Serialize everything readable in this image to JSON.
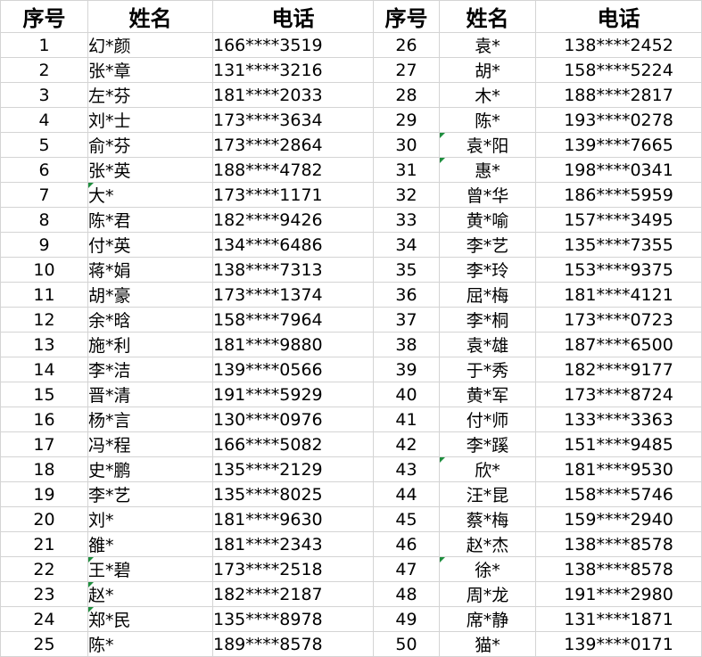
{
  "headers": {
    "seq": "序号",
    "name": "姓名",
    "phone": "电话"
  },
  "colors": {
    "grid_line": "#d4d4d4",
    "flag_green": "#1e8e3e"
  },
  "rows": [
    {
      "left": {
        "seq": "1",
        "name": "幻*颜",
        "phone": "166****3519",
        "flag": false
      },
      "right": {
        "seq": "26",
        "name": "袁*",
        "phone": "138****2452",
        "flag": false
      }
    },
    {
      "left": {
        "seq": "2",
        "name": "张*章",
        "phone": "131****3216",
        "flag": false
      },
      "right": {
        "seq": "27",
        "name": "胡*",
        "phone": "158****5224",
        "flag": false
      }
    },
    {
      "left": {
        "seq": "3",
        "name": "左*芬",
        "phone": "181****2033",
        "flag": false
      },
      "right": {
        "seq": "28",
        "name": "木*",
        "phone": "188****2817",
        "flag": false
      }
    },
    {
      "left": {
        "seq": "4",
        "name": "刘*士",
        "phone": "173****3634",
        "flag": false
      },
      "right": {
        "seq": "29",
        "name": "陈*",
        "phone": "193****0278",
        "flag": false
      }
    },
    {
      "left": {
        "seq": "5",
        "name": "俞*芬",
        "phone": "173****2864",
        "flag": false
      },
      "right": {
        "seq": "30",
        "name": "袁*阳",
        "phone": "139****7665",
        "flag": true
      }
    },
    {
      "left": {
        "seq": "6",
        "name": "张*英",
        "phone": "188****4782",
        "flag": false
      },
      "right": {
        "seq": "31",
        "name": "惠*",
        "phone": "198****0341",
        "flag": true
      }
    },
    {
      "left": {
        "seq": "7",
        "name": "大*",
        "phone": "173****1171",
        "flag": true
      },
      "right": {
        "seq": "32",
        "name": "曾*华",
        "phone": "186****5959",
        "flag": false
      }
    },
    {
      "left": {
        "seq": "8",
        "name": "陈*君",
        "phone": "182****9426",
        "flag": false
      },
      "right": {
        "seq": "33",
        "name": "黄*喻",
        "phone": "157****3495",
        "flag": false
      }
    },
    {
      "left": {
        "seq": "9",
        "name": "付*英",
        "phone": "134****6486",
        "flag": false
      },
      "right": {
        "seq": "34",
        "name": "李*艺",
        "phone": "135****7355",
        "flag": false
      }
    },
    {
      "left": {
        "seq": "10",
        "name": "蒋*娟",
        "phone": "138****7313",
        "flag": false
      },
      "right": {
        "seq": "35",
        "name": "李*玲",
        "phone": "153****9375",
        "flag": false
      }
    },
    {
      "left": {
        "seq": "11",
        "name": "胡*豪",
        "phone": "173****1374",
        "flag": false
      },
      "right": {
        "seq": "36",
        "name": "屈*梅",
        "phone": "181****4121",
        "flag": false
      }
    },
    {
      "left": {
        "seq": "12",
        "name": "余*晗",
        "phone": "158****7964",
        "flag": false
      },
      "right": {
        "seq": "37",
        "name": "李*桐",
        "phone": "173****0723",
        "flag": false
      }
    },
    {
      "left": {
        "seq": "13",
        "name": "施*利",
        "phone": "181****9880",
        "flag": false
      },
      "right": {
        "seq": "38",
        "name": "袁*雄",
        "phone": "187****6500",
        "flag": false
      }
    },
    {
      "left": {
        "seq": "14",
        "name": "李*洁",
        "phone": "139****0566",
        "flag": false
      },
      "right": {
        "seq": "39",
        "name": "于*秀",
        "phone": "182****9177",
        "flag": false
      }
    },
    {
      "left": {
        "seq": "15",
        "name": "晋*清",
        "phone": "191****5929",
        "flag": false
      },
      "right": {
        "seq": "40",
        "name": "黄*军",
        "phone": "173****8724",
        "flag": false
      }
    },
    {
      "left": {
        "seq": "16",
        "name": "杨*言",
        "phone": "130****0976",
        "flag": false
      },
      "right": {
        "seq": "41",
        "name": "付*师",
        "phone": "133****3363",
        "flag": false
      }
    },
    {
      "left": {
        "seq": "17",
        "name": "冯*程",
        "phone": "166****5082",
        "flag": false
      },
      "right": {
        "seq": "42",
        "name": "李*蹊",
        "phone": "151****9485",
        "flag": false
      }
    },
    {
      "left": {
        "seq": "18",
        "name": "史*鹏",
        "phone": "135****2129",
        "flag": false
      },
      "right": {
        "seq": "43",
        "name": "欣*",
        "phone": "181****9530",
        "flag": true
      }
    },
    {
      "left": {
        "seq": "19",
        "name": "李*艺",
        "phone": "135****8025",
        "flag": false
      },
      "right": {
        "seq": "44",
        "name": "汪*昆",
        "phone": "158****5746",
        "flag": false
      }
    },
    {
      "left": {
        "seq": "20",
        "name": "刘*",
        "phone": "181****9630",
        "flag": false
      },
      "right": {
        "seq": "45",
        "name": "蔡*梅",
        "phone": "159****2940",
        "flag": false
      }
    },
    {
      "left": {
        "seq": "21",
        "name": "雒*",
        "phone": "181****2343",
        "flag": false
      },
      "right": {
        "seq": "46",
        "name": "赵*杰",
        "phone": "138****8578",
        "flag": false
      }
    },
    {
      "left": {
        "seq": "22",
        "name": "王*碧",
        "phone": "173****2518",
        "flag": true
      },
      "right": {
        "seq": "47",
        "name": "徐*",
        "phone": "138****8578",
        "flag": true
      }
    },
    {
      "left": {
        "seq": "23",
        "name": "赵*",
        "phone": "182****2187",
        "flag": true
      },
      "right": {
        "seq": "48",
        "name": "周*龙",
        "phone": "191****2980",
        "flag": false
      }
    },
    {
      "left": {
        "seq": "24",
        "name": "郑*民",
        "phone": "135****8978",
        "flag": true
      },
      "right": {
        "seq": "49",
        "name": "席*静",
        "phone": "131****1871",
        "flag": false
      }
    },
    {
      "left": {
        "seq": "25",
        "name": "陈*",
        "phone": "189****8578",
        "flag": false
      },
      "right": {
        "seq": "50",
        "name": "猫*",
        "phone": "139****0171",
        "flag": false
      }
    }
  ]
}
